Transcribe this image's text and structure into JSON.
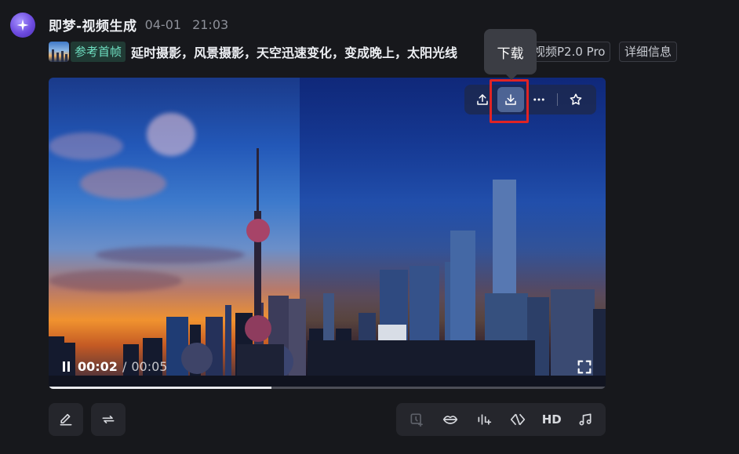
{
  "header": {
    "app_name": "即梦-视频生成",
    "date": "04-01",
    "time": "21:03"
  },
  "prompt": {
    "reference_label": "参考首帧",
    "text": "延时摄影，风景摄影，天空迅速变化，变成晚上，太阳光线",
    "model_tag": "视频P2.0 Pro",
    "details_button": "详细信息"
  },
  "tooltip": {
    "text": "下载"
  },
  "video": {
    "current_time": "00:02",
    "separator": "/",
    "total_time": "00:05",
    "progress_fraction": 0.4,
    "toolbar": [
      {
        "name": "share-icon"
      },
      {
        "name": "download-icon"
      },
      {
        "name": "more-icon"
      },
      {
        "name": "star-icon"
      }
    ]
  },
  "bottom_actions": {
    "left": [
      {
        "name": "edit-icon"
      },
      {
        "name": "regenerate-icon"
      }
    ],
    "right": [
      {
        "name": "frame-interpolate-icon",
        "disabled": true
      },
      {
        "name": "lip-sync-icon"
      },
      {
        "name": "sound-effect-icon"
      },
      {
        "name": "enhance-icon"
      },
      {
        "name": "hd-label",
        "label": "HD"
      },
      {
        "name": "music-icon"
      }
    ]
  },
  "colors": {
    "background": "#17181c",
    "accent_reference": "#6fe0c2",
    "highlight": "#e02424"
  }
}
